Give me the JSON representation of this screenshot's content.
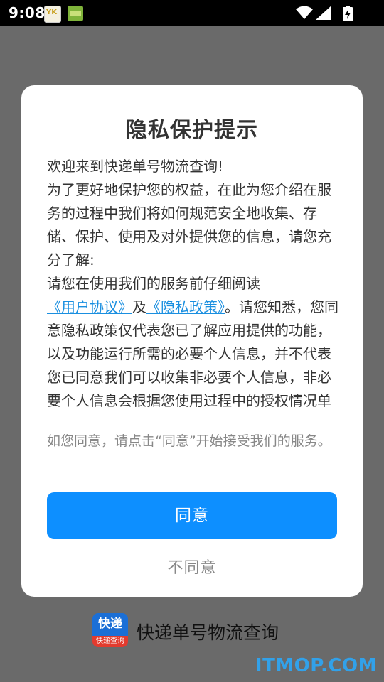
{
  "status_bar": {
    "time": "9:08"
  },
  "dialog": {
    "title": "隐私保护提示",
    "body": {
      "greeting": "欢迎来到快递单号物流查询!",
      "para1": "为了更好地保护您的权益，在此为您介绍在服务的过程中我们将如何规范安全地收集、存储、保护、使用及对外提供您的信息，请您充分了解:",
      "para2_before": "请您在使用我们的服务前仔细阅读",
      "user_agreement_link": "《用户协议》",
      "and_text": "及",
      "privacy_policy_link": "《隐私政策》",
      "para2_after": "。请您知悉，您同意隐私政策仅代表您已了解应用提供的功能，以及功能运行所需的必要个人信息，并不代表您已同意我们可以收集非必要个人信息，非必要个人信息会根据您使用过程中的授权情况单独征求"
    },
    "agree_hint": "如您同意，请点击“同意”开始接受我们的服务。",
    "agree_label": "同意",
    "disagree_label": "不同意"
  },
  "footer": {
    "logo_text_top": "快递",
    "logo_text_bottom": "快递查询",
    "app_name": "快递单号物流查询"
  },
  "watermark": "ITMOP.COM",
  "colors": {
    "accent": "#0d8fff",
    "link": "#1a8fe0",
    "overlay": "#6a6a6a"
  }
}
